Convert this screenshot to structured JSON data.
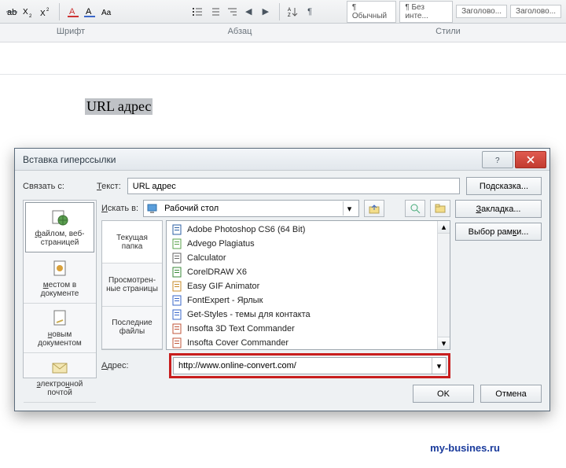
{
  "ribbon": {
    "group_font": "Шрифт",
    "group_para": "Абзац",
    "group_styles": "Стили",
    "styles": [
      "¶ Обычный",
      "¶ Без инте...",
      "Заголово...",
      "Заголово..."
    ]
  },
  "doc": {
    "selected_text": "URL адрес"
  },
  "dialog": {
    "title": "Вставка гиперссылки",
    "link_to": "Связать с:",
    "text_label": "Текст:",
    "text_value": "URL адрес",
    "hint_btn": "Подсказка...",
    "tabs": {
      "file_web": "файлом, веб-страницей",
      "place": "местом в документе",
      "newdoc": "новым документом",
      "email": "электронной почтой"
    },
    "look_in_label": "Искать в:",
    "look_in_value": "Рабочий стол",
    "bookmark_btn": "Закладка...",
    "frame_btn": "Выбор рамки...",
    "side_tabs": {
      "current": "Текущая папка",
      "browsed": "Просмотрен-ные страницы",
      "recent": "Последние файлы"
    },
    "files": [
      "Adobe Photoshop CS6 (64 Bit)",
      "Advego Plagiatus",
      "Calculator",
      "CorelDRAW X6",
      "Easy GIF Animator",
      "FontExpert - Ярлык",
      "Get-Styles - темы для контакта",
      "Insofta 3D Text Commander",
      "Insofta Cover Commander"
    ],
    "address_label": "Адрес:",
    "address_value": "http://www.online-convert.com/",
    "ok": "OK",
    "cancel": "Отмена"
  },
  "watermark": "my-busines.ru"
}
